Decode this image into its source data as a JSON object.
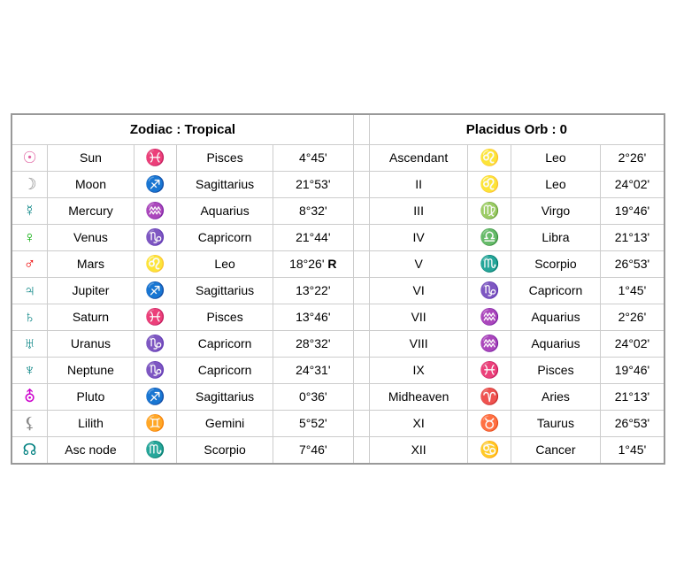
{
  "header": {
    "left_title": "Zodiac : Tropical",
    "right_title": "Placidus Orb : 0"
  },
  "planets": [
    {
      "id": "sun",
      "icon": "☉",
      "icon_color": "color-pink",
      "name": "Sun",
      "sign_icon": "♓",
      "sign_icon_color": "color-green",
      "sign": "Pisces",
      "degree": "4°45'",
      "retro": ""
    },
    {
      "id": "moon",
      "icon": "☽",
      "icon_color": "color-gray",
      "name": "Moon",
      "sign_icon": "♐",
      "sign_icon_color": "color-purple",
      "sign": "Sagittarius",
      "degree": "21°53'",
      "retro": ""
    },
    {
      "id": "mercury",
      "icon": "☿",
      "icon_color": "color-teal",
      "name": "Mercury",
      "sign_icon": "♒",
      "sign_icon_color": "color-cyan",
      "sign": "Aquarius",
      "degree": "8°32'",
      "retro": ""
    },
    {
      "id": "venus",
      "icon": "♀",
      "icon_color": "color-green",
      "name": "Venus",
      "sign_icon": "♑",
      "sign_icon_color": "color-red",
      "sign": "Capricorn",
      "degree": "21°44'",
      "retro": ""
    },
    {
      "id": "mars",
      "icon": "♂",
      "icon_color": "color-red",
      "name": "Mars",
      "sign_icon": "♌",
      "sign_icon_color": "color-gray",
      "sign": "Leo",
      "degree": "18°26'",
      "retro": "R"
    },
    {
      "id": "jupiter",
      "icon": "♃",
      "icon_color": "color-teal",
      "name": "Jupiter",
      "sign_icon": "♐",
      "sign_icon_color": "color-purple",
      "sign": "Sagittarius",
      "degree": "13°22'",
      "retro": ""
    },
    {
      "id": "saturn",
      "icon": "♄",
      "icon_color": "color-teal",
      "name": "Saturn",
      "sign_icon": "♓",
      "sign_icon_color": "color-green",
      "sign": "Pisces",
      "degree": "13°46'",
      "retro": ""
    },
    {
      "id": "uranus",
      "icon": "♅",
      "icon_color": "color-teal",
      "name": "Uranus",
      "sign_icon": "♑",
      "sign_icon_color": "color-red",
      "sign": "Capricorn",
      "degree": "28°32'",
      "retro": ""
    },
    {
      "id": "neptune",
      "icon": "♆",
      "icon_color": "color-teal",
      "name": "Neptune",
      "sign_icon": "♑",
      "sign_icon_color": "color-red",
      "sign": "Capricorn",
      "degree": "24°31'",
      "retro": ""
    },
    {
      "id": "pluto",
      "icon": "⛢",
      "icon_color": "color-magenta",
      "name": "Pluto",
      "sign_icon": "♐",
      "sign_icon_color": "color-purple",
      "sign": "Sagittarius",
      "degree": "0°36'",
      "retro": ""
    },
    {
      "id": "lilith",
      "icon": "⚸",
      "icon_color": "color-gray",
      "name": "Lilith",
      "sign_icon": "♊",
      "sign_icon_color": "color-red",
      "sign": "Gemini",
      "degree": "5°52'",
      "retro": ""
    },
    {
      "id": "ascnode",
      "icon": "☊",
      "icon_color": "color-teal",
      "name": "Asc node",
      "sign_icon": "♏",
      "sign_icon_color": "color-green",
      "sign": "Scorpio",
      "degree": "7°46'",
      "retro": ""
    }
  ],
  "houses": [
    {
      "id": "asc",
      "name": "Ascendant",
      "sign_icon": "♌",
      "sign_icon_color": "color-gray",
      "sign": "Leo",
      "degree": "2°26'"
    },
    {
      "id": "h2",
      "name": "II",
      "sign_icon": "♌",
      "sign_icon_color": "color-gray",
      "sign": "Leo",
      "degree": "24°02'"
    },
    {
      "id": "h3",
      "name": "III",
      "sign_icon": "♍",
      "sign_icon_color": "color-red",
      "sign": "Virgo",
      "degree": "19°46'"
    },
    {
      "id": "h4",
      "name": "IV",
      "sign_icon": "♎",
      "sign_icon_color": "color-green",
      "sign": "Libra",
      "degree": "21°13'"
    },
    {
      "id": "h5",
      "name": "V",
      "sign_icon": "♏",
      "sign_icon_color": "color-red",
      "sign": "Scorpio",
      "degree": "26°53'"
    },
    {
      "id": "h6",
      "name": "VI",
      "sign_icon": "♑",
      "sign_icon_color": "color-red",
      "sign": "Capricorn",
      "degree": "1°45'"
    },
    {
      "id": "h7",
      "name": "VII",
      "sign_icon": "♒",
      "sign_icon_color": "color-cyan",
      "sign": "Aquarius",
      "degree": "2°26'"
    },
    {
      "id": "h8",
      "name": "VIII",
      "sign_icon": "♒",
      "sign_icon_color": "color-cyan",
      "sign": "Aquarius",
      "degree": "24°02'"
    },
    {
      "id": "h9",
      "name": "IX",
      "sign_icon": "♓",
      "sign_icon_color": "color-green",
      "sign": "Pisces",
      "degree": "19°46'"
    },
    {
      "id": "mc",
      "name": "Midheaven",
      "sign_icon": "♈",
      "sign_icon_color": "color-red",
      "sign": "Aries",
      "degree": "21°13'"
    },
    {
      "id": "h11",
      "name": "XI",
      "sign_icon": "♉",
      "sign_icon_color": "color-red",
      "sign": "Taurus",
      "degree": "26°53'"
    },
    {
      "id": "h12",
      "name": "XII",
      "sign_icon": "♋",
      "sign_icon_color": "color-cyan",
      "sign": "Cancer",
      "degree": "1°45'"
    }
  ]
}
